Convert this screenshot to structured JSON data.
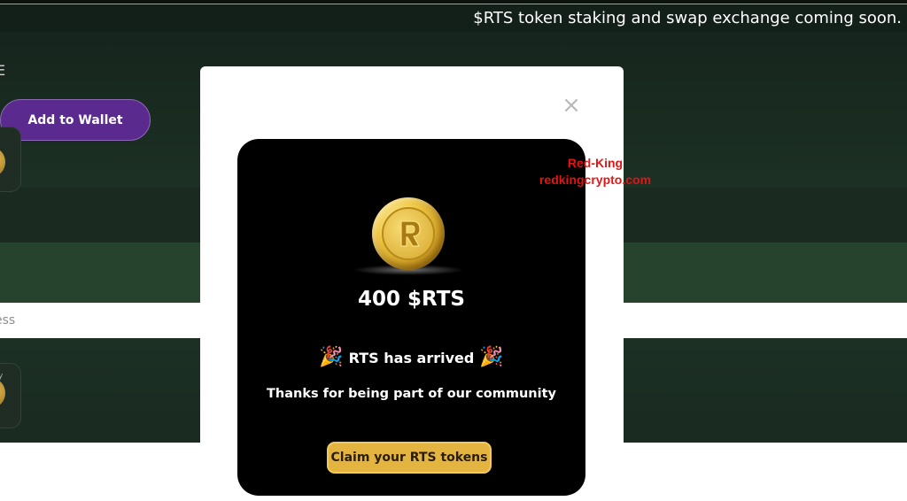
{
  "ticker": {
    "text": "$RTS token staking and swap exchange coming soon."
  },
  "background": {
    "add_wallet_label": "Add to Wallet",
    "partial_text": "ess",
    "partial_glyph": "E",
    "tiny_label": "y"
  },
  "modal": {
    "close_glyph": "×",
    "amount": "400 $RTS",
    "arrived": "RTS has arrived",
    "confetti": "🎉",
    "thanks": "Thanks for being part of our community",
    "claim_label": "Claim your RTS tokens"
  },
  "watermark": {
    "line1": "Red-King",
    "line2": "redkingcrypto.com"
  },
  "colors": {
    "accent_purple": "#5a2a8e",
    "gold": "#e3b440",
    "watermark_red": "#e01515"
  }
}
